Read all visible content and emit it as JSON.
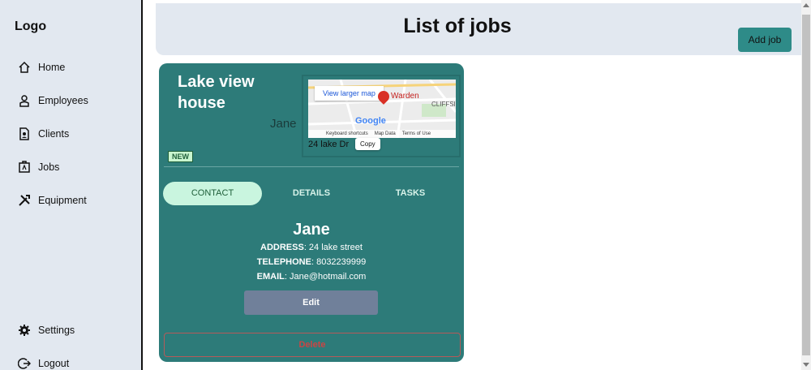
{
  "sidebar": {
    "logo": "Logo",
    "items": [
      {
        "label": "Home",
        "icon": "home-icon"
      },
      {
        "label": "Employees",
        "icon": "employees-icon"
      },
      {
        "label": "Clients",
        "icon": "clients-icon"
      },
      {
        "label": "Jobs",
        "icon": "jobs-icon"
      },
      {
        "label": "Equipment",
        "icon": "equipment-icon"
      }
    ],
    "bottom_items": [
      {
        "label": "Settings",
        "icon": "gear-icon"
      },
      {
        "label": "Logout",
        "icon": "logout-icon"
      }
    ]
  },
  "header": {
    "title": "List of jobs",
    "add_button": "Add job"
  },
  "job": {
    "title": "Lake view house",
    "client": "Jane",
    "badge": "NEW",
    "map": {
      "larger_map": "View larger map",
      "place": "Warden",
      "place2": "CLIFFSIDE",
      "google": "Google",
      "footer": [
        "Keyboard shortcuts",
        "Map Data",
        "Terms of Use"
      ],
      "address": "24 lake Dr",
      "copy": "Copy"
    },
    "tabs": [
      "CONTACT",
      "DETAILS",
      "TASKS"
    ],
    "active_tab": "CONTACT",
    "contact": {
      "name": "Jane",
      "address_label": "ADDRESS",
      "address": ": 24 lake street",
      "telephone_label": "TELEPHONE",
      "telephone": ": 8032239999",
      "email_label": "EMAIL",
      "email": ": Jane@hotmail.com"
    },
    "edit_button": "Edit",
    "delete_button": "Delete"
  },
  "colors": {
    "card": "#2d7b79",
    "sidebar": "#e2e8f0",
    "accent": "#2e8b88",
    "active_tab": "#c9f5df"
  }
}
